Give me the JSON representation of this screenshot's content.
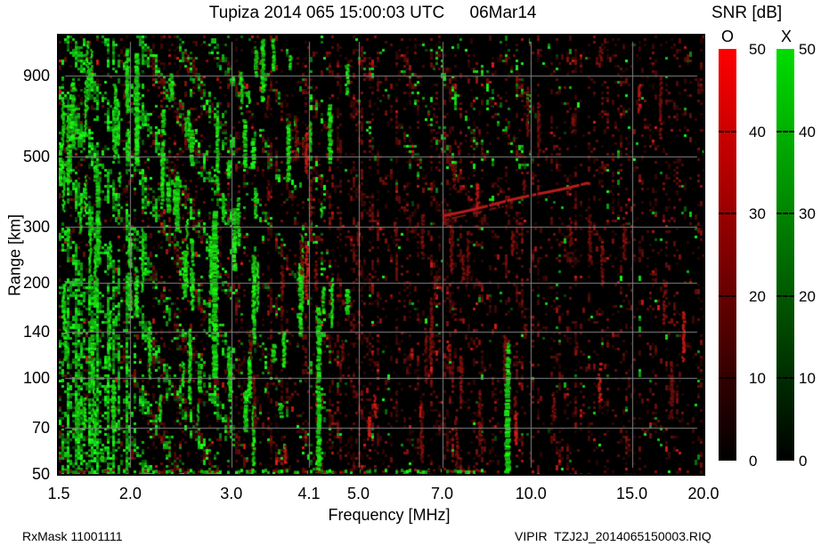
{
  "header": {
    "title": "Tupiza 2014 065 15:00:03 UTC",
    "date": "06Mar14"
  },
  "footer": {
    "left": "RxMask 11001111",
    "right": "VIPIR  TZJ2J_2014065150003.RIQ"
  },
  "chart_data": {
    "type": "heatmap",
    "title": "Tupiza 2014 065 15:00:03 UTC",
    "date_label": "06Mar14",
    "xlabel": "Frequency [MHz]",
    "ylabel": "Range [km]",
    "x_scale": "log",
    "y_scale": "log",
    "xlim": [
      1.5,
      20.0
    ],
    "ylim": [
      50,
      1200
    ],
    "x_ticks": [
      1.5,
      2.0,
      3.0,
      4.1,
      5.0,
      7.0,
      10.0,
      15.0,
      20.0
    ],
    "x_tick_labels": [
      "1.5",
      "2.0",
      "3.0",
      "4.1",
      "5.0",
      "7.0",
      "10.0",
      "15.0",
      "20.0"
    ],
    "y_ticks": [
      50,
      70,
      100,
      140,
      200,
      300,
      500,
      900
    ],
    "y_tick_labels": [
      "50",
      "70",
      "100",
      "140",
      "200",
      "300",
      "500",
      "900"
    ],
    "grid": true,
    "grid_color": "#848484",
    "background": "#000000",
    "colorbar": {
      "title": "SNR [dB]",
      "min": 0,
      "max": 50,
      "ticks": [
        50,
        40,
        30,
        20,
        10,
        0
      ],
      "channels": [
        {
          "label": "O",
          "top_color": "#ff0000",
          "bottom_color": "#000000"
        },
        {
          "label": "X",
          "top_color": "#00dd00",
          "bottom_color": "#000000"
        }
      ]
    },
    "annotations": {
      "oblique_echo": {
        "description": "thin red oblique echo trace rising left-to-right",
        "freq_mhz": [
          7.2,
          12.6
        ],
        "range_km": [
          324,
          406
        ]
      }
    },
    "texture": {
      "seed": 1402,
      "cell": 3,
      "diag": {
        "slope": 0.5,
        "period": 40,
        "sharp": 2.6,
        "gain": 1.9,
        "base": 0.1
      },
      "col_var": {
        "min": 0.25,
        "span": 1.75,
        "pow": 2
      },
      "green_zones": [
        [
          0.0,
          0.13,
          0.0,
          1.0,
          0.42,
          1
        ],
        [
          0.0,
          0.12,
          0.55,
          1.0,
          0.5,
          0
        ],
        [
          0.13,
          0.27,
          0.0,
          1.0,
          0.22,
          1
        ],
        [
          0.27,
          0.42,
          0.0,
          1.0,
          0.08,
          1
        ],
        [
          0.42,
          0.62,
          0.0,
          0.35,
          0.045,
          1
        ],
        [
          0.55,
          0.73,
          0.0,
          0.3,
          0.1,
          1
        ],
        [
          0.0,
          1.0,
          0.0,
          1.0,
          0.01,
          0
        ]
      ],
      "red_zones": [
        [
          0.0,
          1.0,
          0.0,
          1.0,
          0.09,
          0
        ],
        [
          0.08,
          0.8,
          0.03,
          1.0,
          0.22,
          1
        ],
        [
          0.8,
          1.0,
          0.0,
          1.0,
          0.13,
          1
        ],
        [
          0.27,
          0.62,
          0.35,
          1.0,
          0.1,
          0
        ]
      ],
      "green_streaks": {
        "count": 90,
        "xmax": 0.46,
        "xpow": 1.5,
        "hmin": 12,
        "hmax": 85
      },
      "red_streaks": {
        "count": 60,
        "xmin": 0.28,
        "xspan": 0.69,
        "hmin": 10,
        "hmax": 70
      },
      "explicit_green": [
        [
          0.238,
          0.4,
          0.78,
          6
        ],
        [
          0.3,
          0.5,
          0.7,
          4
        ],
        [
          0.4,
          0.62,
          0.99,
          5
        ],
        [
          0.692,
          0.7,
          0.995,
          6
        ],
        [
          0.118,
          0.04,
          0.3,
          5
        ],
        [
          0.058,
          0.33,
          0.52,
          5
        ]
      ],
      "bottom_band": {
        "xmax": 0.66,
        "g": 0.5,
        "r": 0.3,
        "h": 6
      },
      "oblique": {
        "x0": 0.595,
        "y0": 0.408,
        "x1": 0.818,
        "y1": 0.333,
        "w": 3,
        "color": [
          185,
          28,
          28
        ]
      }
    }
  }
}
